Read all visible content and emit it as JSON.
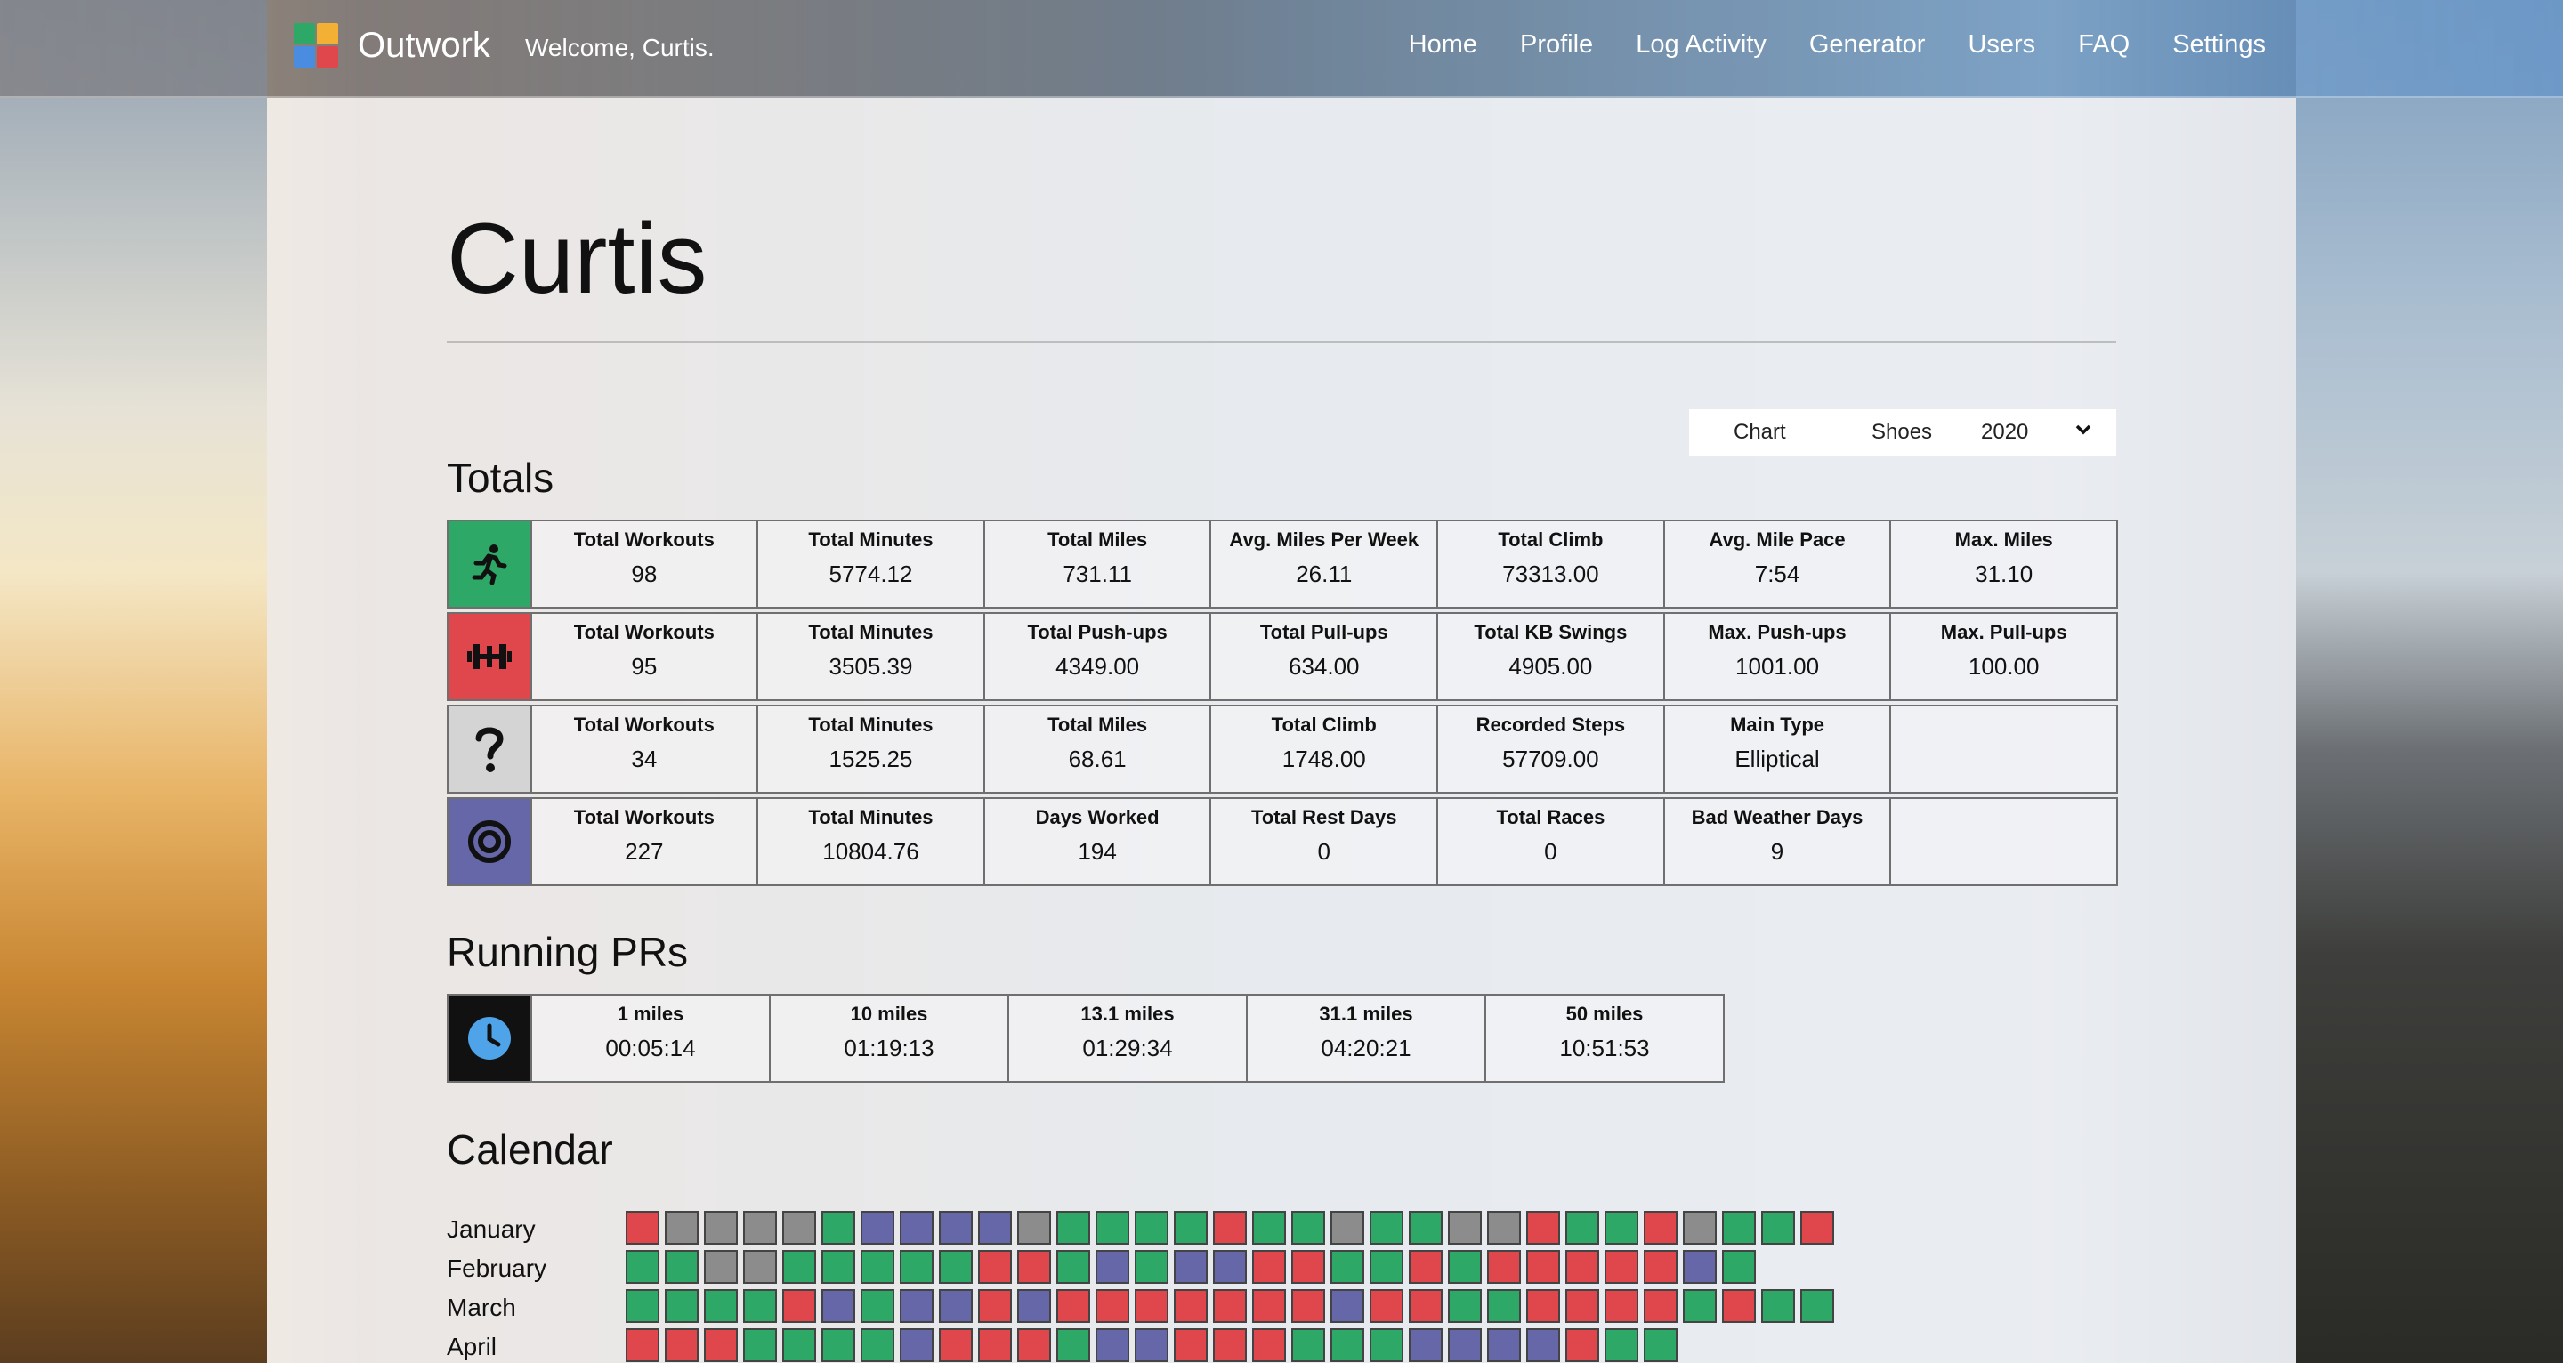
{
  "colors": {
    "run": "#2ea866",
    "strength": "#e0474c",
    "other": "#d4d4d4",
    "total": "#6567a8",
    "pr": "#111111",
    "rest": "#8c8c8c"
  },
  "brand": {
    "name": "Outwork",
    "welcome": "Welcome, Curtis."
  },
  "nav": [
    "Home",
    "Profile",
    "Log Activity",
    "Generator",
    "Users",
    "FAQ",
    "Settings"
  ],
  "page": {
    "title": "Curtis"
  },
  "controls": {
    "chart_label": "Chart",
    "shoes_label": "Shoes",
    "year_value": "2020"
  },
  "totals": {
    "heading": "Totals",
    "rows": [
      {
        "icon": "running-icon",
        "cells": [
          {
            "label": "Total Workouts",
            "value": "98"
          },
          {
            "label": "Total Minutes",
            "value": "5774.12"
          },
          {
            "label": "Total Miles",
            "value": "731.11"
          },
          {
            "label": "Avg. Miles Per Week",
            "value": "26.11"
          },
          {
            "label": "Total Climb",
            "value": "73313.00"
          },
          {
            "label": "Avg. Mile Pace",
            "value": "7:54"
          },
          {
            "label": "Max. Miles",
            "value": "31.10"
          }
        ]
      },
      {
        "icon": "dumbbell-icon",
        "cells": [
          {
            "label": "Total Workouts",
            "value": "95"
          },
          {
            "label": "Total Minutes",
            "value": "3505.39"
          },
          {
            "label": "Total Push-ups",
            "value": "4349.00"
          },
          {
            "label": "Total Pull-ups",
            "value": "634.00"
          },
          {
            "label": "Total KB Swings",
            "value": "4905.00"
          },
          {
            "label": "Max. Push-ups",
            "value": "1001.00"
          },
          {
            "label": "Max. Pull-ups",
            "value": "100.00"
          }
        ]
      },
      {
        "icon": "question-icon",
        "cells": [
          {
            "label": "Total Workouts",
            "value": "34"
          },
          {
            "label": "Total Minutes",
            "value": "1525.25"
          },
          {
            "label": "Total Miles",
            "value": "68.61"
          },
          {
            "label": "Total Climb",
            "value": "1748.00"
          },
          {
            "label": "Recorded Steps",
            "value": "57709.00"
          },
          {
            "label": "Main Type",
            "value": "Elliptical"
          },
          {
            "label": "",
            "value": ""
          }
        ]
      },
      {
        "icon": "target-icon",
        "cells": [
          {
            "label": "Total Workouts",
            "value": "227"
          },
          {
            "label": "Total Minutes",
            "value": "10804.76"
          },
          {
            "label": "Days Worked",
            "value": "194"
          },
          {
            "label": "Total Rest Days",
            "value": "0"
          },
          {
            "label": "Total Races",
            "value": "0"
          },
          {
            "label": "Bad Weather Days",
            "value": "9"
          },
          {
            "label": "",
            "value": ""
          }
        ]
      }
    ]
  },
  "prs": {
    "heading": "Running PRs",
    "icon": "clock-icon",
    "cells": [
      {
        "label": "1 miles",
        "value": "00:05:14"
      },
      {
        "label": "10 miles",
        "value": "01:19:13"
      },
      {
        "label": "13.1 miles",
        "value": "01:29:34"
      },
      {
        "label": "31.1 miles",
        "value": "04:20:21"
      },
      {
        "label": "50 miles",
        "value": "10:51:53"
      }
    ]
  },
  "calendar": {
    "heading": "Calendar",
    "months": [
      {
        "name": "January",
        "days": "RGGGGrPPPPGrrrrRrrGrrGGRrrRGrrR"
      },
      {
        "name": "February",
        "days": "rrGGrrrrrRRrPrPPRRrrRrRRRRRPr"
      },
      {
        "name": "March",
        "days": "rrrrRPrPPRPRRRRRRRPRRrrRRRRrRrr"
      },
      {
        "name": "April",
        "days": "RRRrrrrPRRRrPPRRRrrrPPPPRrr"
      }
    ]
  }
}
